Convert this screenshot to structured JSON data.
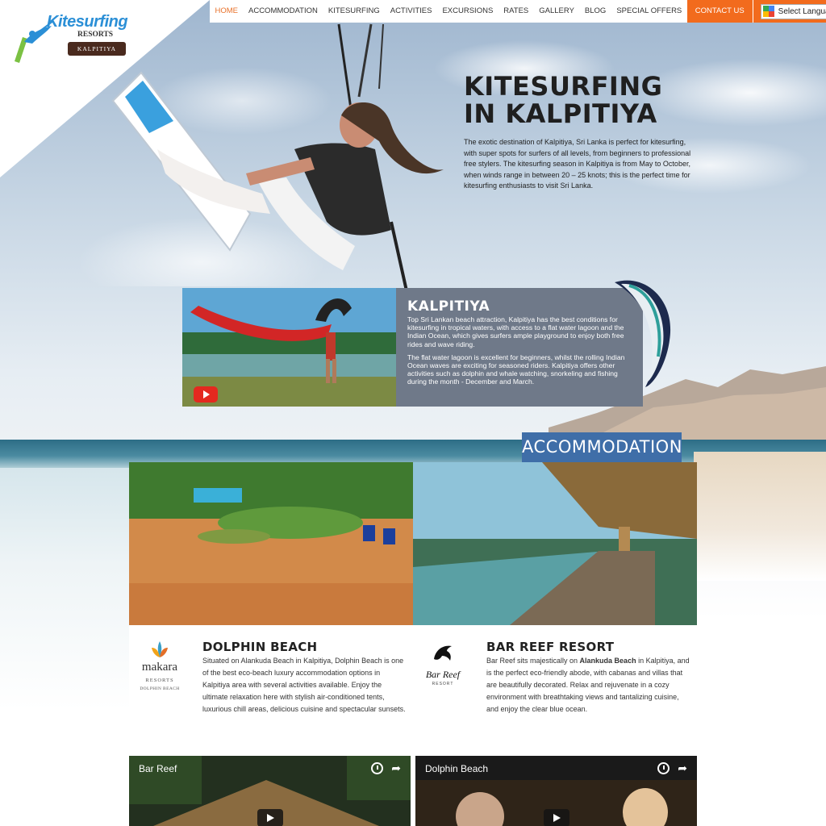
{
  "nav": {
    "items": [
      "HOME",
      "ACCOMMODATION",
      "KITESURFING",
      "ACTIVITIES",
      "EXCURSIONS",
      "RATES",
      "GALLERY",
      "BLOG",
      "SPECIAL OFFERS"
    ],
    "contact": "CONTACT US",
    "language": "Select Language",
    "active_color": "#e8712a",
    "contact_color": "#f26b1d"
  },
  "logo": {
    "title": "Kitesurfing",
    "resorts": "RESORTS",
    "banner": "KALPITIYA"
  },
  "hero": {
    "title": "KITESURFING\nIN KALPITIYA",
    "body": "The exotic destination of Kalpitiya, Sri Lanka is perfect for kitesurfing, with super spots for surfers of all levels, from beginners to professional free stylers. The kitesurfing season in Kalpitiya is from May to October, when winds range in between 20 – 25 knots; this is the perfect time for kitesurfing enthusiasts to visit Sri Lanka."
  },
  "kalpitiya": {
    "title": "KALPITIYA",
    "p1": "Top Sri Lankan beach attraction, Kalpitiya has the best conditions for kitesurfing in tropical waters, with access to a flat water lagoon and the Indian Ocean, which gives surfers ample playground to enjoy both free rides and wave riding.",
    "p2": "The flat water lagoon is excellent for beginners, whilst the rolling Indian Ocean waves are exciting for seasoned riders. Kalpitiya offers other activities such as dolphin and whale watching, snorkeling and fishing during the month - December and March."
  },
  "accommodation": {
    "heading": "ACCOMMODATION",
    "accent": "#3f6ea8",
    "cards": [
      {
        "title": "DOLPHIN BEACH",
        "body": "Situated on Alankuda Beach in Kalpitiya, Dolphin Beach is one of the best eco-beach luxury accommodation options in Kalpitiya area with several activities available. Enjoy the ultimate relaxation here with stylish air-conditioned tents, luxurious chill areas, delicious cuisine and spectacular sunsets.",
        "logo_word": "makara",
        "logo_resorts": "RESORTS",
        "logo_sub": "DOLPHIN BEACH"
      },
      {
        "title": "BAR REEF RESORT",
        "body_pre": "Bar Reef sits majestically on ",
        "body_bold": "Alankuda Beach",
        "body_post": " in Kalpitiya, and is the perfect eco-friendly abode, with cabanas and villas that are beautifully decorated. Relax and rejuvenate in a cozy environment with breathtaking views and tantalizing cuisine, and enjoy the clear blue ocean.",
        "logo_word": "Bar Reef",
        "logo_sub": "RESORT"
      }
    ]
  },
  "videos": [
    {
      "title": "Bar Reef"
    },
    {
      "title": "Dolphin Beach"
    }
  ]
}
